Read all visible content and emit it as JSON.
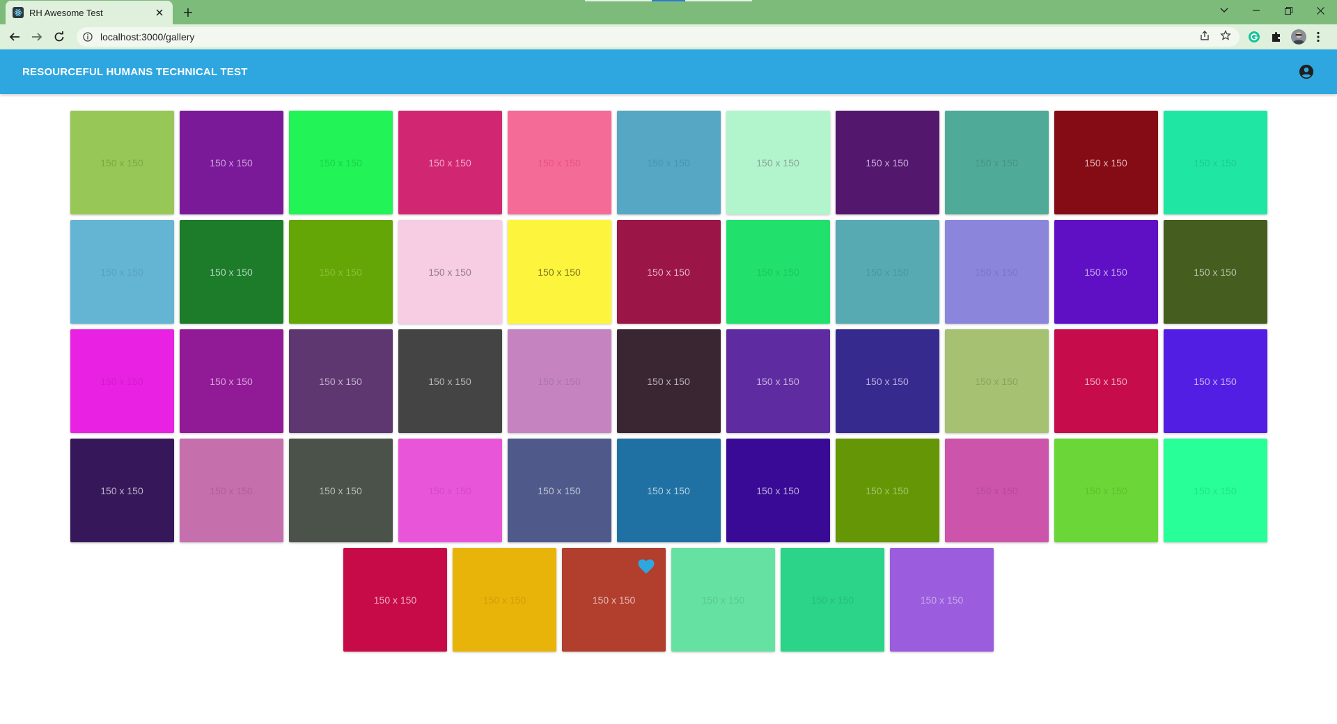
{
  "browser": {
    "tab_title": "RH Awesome Test",
    "url": "localhost:3000/gallery"
  },
  "app": {
    "title": "RESOURCEFUL HUMANS TECHNICAL TEST",
    "account_icon": "account-circle-icon",
    "accent_color": "#2ea7e0"
  },
  "gallery": {
    "tiles": [
      {
        "label": "150 x 150",
        "color": "#97c857",
        "text_color": "#7aa842"
      },
      {
        "label": "150 x 150",
        "color": "#7b1a99",
        "text_color": "#c7a2d6"
      },
      {
        "label": "150 x 150",
        "color": "#22f356",
        "text_color": "#1ad44a"
      },
      {
        "label": "150 x 150",
        "color": "#d12773",
        "text_color": "#f2a9c8"
      },
      {
        "label": "150 x 150",
        "color": "#f56b98",
        "text_color": "#e75387"
      },
      {
        "label": "150 x 150",
        "color": "#55a7c4",
        "text_color": "#4a96b1"
      },
      {
        "label": "150 x 150",
        "color": "#b2f5cc",
        "text_color": "#8ba59a"
      },
      {
        "label": "150 x 150",
        "color": "#53176e",
        "text_color": "#c9aad6"
      },
      {
        "label": "150 x 150",
        "color": "#50aa98",
        "text_color": "#449586"
      },
      {
        "label": "150 x 150",
        "color": "#850b15",
        "text_color": "#e2b2b6"
      },
      {
        "label": "150 x 150",
        "color": "#20e6a3",
        "text_color": "#1ccd90"
      },
      {
        "label": "150 x 150",
        "color": "#64b4d3",
        "text_color": "#58a2bf"
      },
      {
        "label": "150 x 150",
        "color": "#1c7c2a",
        "text_color": "#b5d6ba"
      },
      {
        "label": "150 x 150",
        "color": "#64a605",
        "text_color": "#8bbf3a"
      },
      {
        "label": "150 x 150",
        "color": "#f7cde3",
        "text_color": "#8f7b86"
      },
      {
        "label": "150 x 150",
        "color": "#fdf53d",
        "text_color": "#7a7620"
      },
      {
        "label": "150 x 150",
        "color": "#9b1646",
        "text_color": "#e7b3c5"
      },
      {
        "label": "150 x 150",
        "color": "#21e06b",
        "text_color": "#1cc75f"
      },
      {
        "label": "150 x 150",
        "color": "#57a9b2",
        "text_color": "#4a98a1"
      },
      {
        "label": "150 x 150",
        "color": "#8b86db",
        "text_color": "#7b76c9"
      },
      {
        "label": "150 x 150",
        "color": "#5f10c5",
        "text_color": "#c6abea"
      },
      {
        "label": "150 x 150",
        "color": "#455d1e",
        "text_color": "#b9c3ab"
      },
      {
        "label": "150 x 150",
        "color": "#e921e3",
        "text_color": "#cf1dc9"
      },
      {
        "label": "150 x 150",
        "color": "#911a96",
        "text_color": "#d4a8d6"
      },
      {
        "label": "150 x 150",
        "color": "#5e3770",
        "text_color": "#c3b3ca"
      },
      {
        "label": "150 x 150",
        "color": "#444444",
        "text_color": "#b8b8b8"
      },
      {
        "label": "150 x 150",
        "color": "#c584bf",
        "text_color": "#ae74a9"
      },
      {
        "label": "150 x 150",
        "color": "#3a2633",
        "text_color": "#b9b0b5"
      },
      {
        "label": "150 x 150",
        "color": "#5e2ba0",
        "text_color": "#c6b3de"
      },
      {
        "label": "150 x 150",
        "color": "#372a8f",
        "text_color": "#b9b3da"
      },
      {
        "label": "150 x 150",
        "color": "#a7c172",
        "text_color": "#8aa35c"
      },
      {
        "label": "150 x 150",
        "color": "#c60c4a",
        "text_color": "#eeb0c4"
      },
      {
        "label": "150 x 150",
        "color": "#531ee3",
        "text_color": "#c5b3f4"
      },
      {
        "label": "150 x 150",
        "color": "#36185a",
        "text_color": "#bcb1c9"
      },
      {
        "label": "150 x 150",
        "color": "#c56fad",
        "text_color": "#b06299"
      },
      {
        "label": "150 x 150",
        "color": "#4b524a",
        "text_color": "#b8bbb8"
      },
      {
        "label": "150 x 150",
        "color": "#e955d9",
        "text_color": "#d24bc3"
      },
      {
        "label": "150 x 150",
        "color": "#4f5a8b",
        "text_color": "#bcc0d3"
      },
      {
        "label": "150 x 150",
        "color": "#2071a3",
        "text_color": "#b1cde0"
      },
      {
        "label": "150 x 150",
        "color": "#380a95",
        "text_color": "#bdaed9"
      },
      {
        "label": "150 x 150",
        "color": "#659605",
        "text_color": "#a3c26b"
      },
      {
        "label": "150 x 150",
        "color": "#cc54ab",
        "text_color": "#b84b99"
      },
      {
        "label": "150 x 150",
        "color": "#6ad637",
        "text_color": "#5dc030"
      },
      {
        "label": "150 x 150",
        "color": "#28ff98",
        "text_color": "#21e585"
      },
      {
        "label": "150 x 150",
        "color": "#c70b48",
        "text_color": "#eeb0c3"
      },
      {
        "label": "150 x 150",
        "color": "#e8b409",
        "text_color": "#cf9f06"
      },
      {
        "label": "150 x 150",
        "color": "#b23e2e",
        "text_color": "#e7bcb6",
        "favorited": true,
        "favorite_icon": "heart-icon",
        "favorite_color": "#2ea7e0"
      },
      {
        "label": "150 x 150",
        "color": "#65e2a1",
        "text_color": "#59c990"
      },
      {
        "label": "150 x 150",
        "color": "#2bd489",
        "text_color": "#25be7a"
      },
      {
        "label": "150 x 150",
        "color": "#9b5cdd",
        "text_color": "#c9aaeb"
      }
    ]
  }
}
